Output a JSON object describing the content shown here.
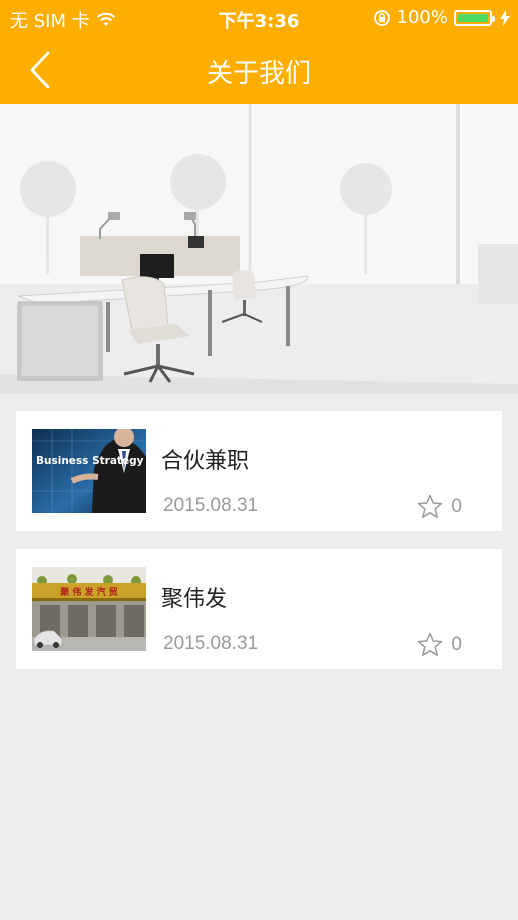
{
  "status_bar": {
    "carrier": "无 SIM 卡",
    "time": "下午3:36",
    "battery_percent": "100%",
    "battery_level": 1.0,
    "icons": [
      "wifi-icon",
      "rotation-lock-icon",
      "battery-icon",
      "charging-icon"
    ]
  },
  "nav": {
    "title": "关于我们",
    "back_icon": "chevron-left-icon"
  },
  "banner": {
    "description_icon": "office-banner-image"
  },
  "items": [
    {
      "title": "合伙兼职",
      "date": "2015.08.31",
      "favorites": "0",
      "thumb_text": "Business Strategy",
      "star_icon": "star-outline-icon"
    },
    {
      "title": "聚伟发",
      "date": "2015.08.31",
      "favorites": "0",
      "thumb_text": "聚 伟 发 汽 贸",
      "star_icon": "star-outline-icon"
    }
  ],
  "colors": {
    "accent": "#fdae00",
    "background": "#ececec",
    "card": "#ffffff",
    "muted_text": "#9a9a9a",
    "battery_fill": "#4cd964"
  }
}
